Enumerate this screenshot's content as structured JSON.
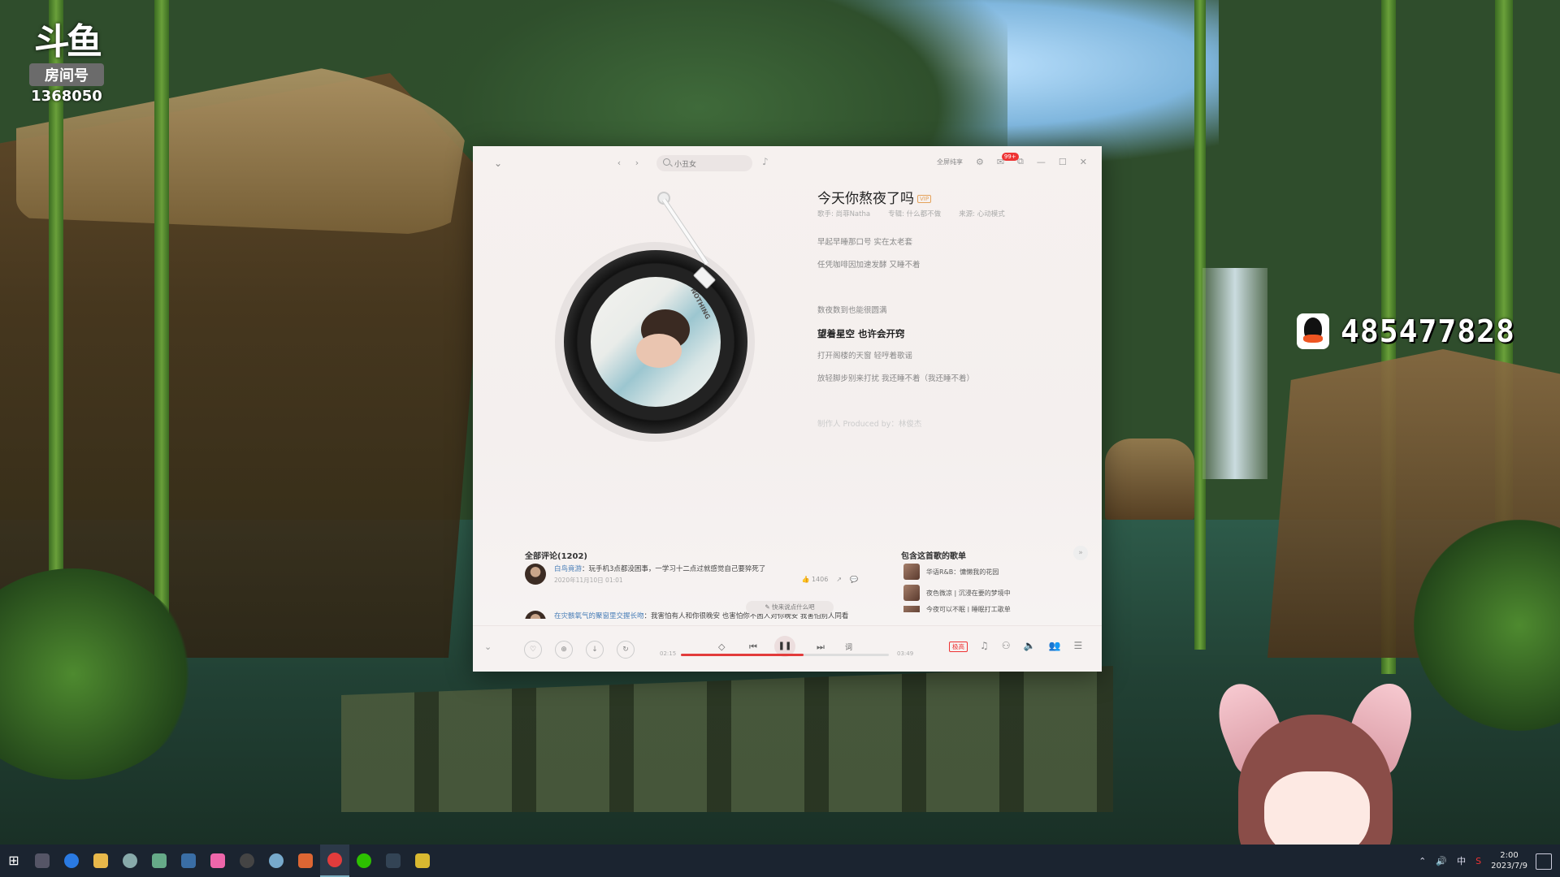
{
  "overlay": {
    "douyu_logo": "斗鱼",
    "douyu_room_label": "房间号",
    "douyu_room_number": "1368050",
    "qq_number": "485477828"
  },
  "player": {
    "search_placeholder": "小丑女",
    "fullscreen_label": "全屏纯享",
    "message_badge": "99+",
    "song": {
      "title": "今天你熬夜了吗",
      "tag": "VIP",
      "singer": "歌手: 尚菲Natha",
      "album": "专辑: 什么都不做",
      "source": "来源: 心动模式"
    },
    "cover_text": "DO NOTHING",
    "lyrics": [
      {
        "text": "早起早睡那口号 实在太老套",
        "state": "normal"
      },
      {
        "text": "任凭咖啡因加速发酵 又睡不着",
        "state": "normal"
      },
      {
        "text": "",
        "state": "normal"
      },
      {
        "text": "数夜数到也能很圆满",
        "state": "normal"
      },
      {
        "text": "望着星空 也许会开窍",
        "state": "active"
      },
      {
        "text": "打开阁楼的天窗 轻哼着歌谣",
        "state": "normal"
      },
      {
        "text": "放轻脚步别来打扰 我还睡不着（我还睡不着）",
        "state": "normal"
      },
      {
        "text": "",
        "state": "normal"
      },
      {
        "text": "制作人 Produced by：林俊杰",
        "state": "faded"
      }
    ],
    "comments": {
      "title": "全部评论(1202)",
      "items": [
        {
          "user": "白鸟竟游",
          "text": "：玩手机3点都没困事，一学习十二点过就感觉自己要猝死了",
          "time": "2020年11月10日 01:01",
          "likes": "1406"
        },
        {
          "user": "在灾骸氧气的聚窗里交握长吻",
          "text": "：我害怕有人和你很晚安 也害怕你不困人对你晚安 我害怕别人同看",
          "time": "",
          "likes": ""
        }
      ],
      "hint": "快来说点什么吧"
    },
    "playlists": {
      "title": "包含这首歌的歌单",
      "items": [
        {
          "name": "华语R&B：慵懒我的花园"
        },
        {
          "name": "夜色微凉 | 沉浸在要的梦境中"
        },
        {
          "name": "今夜可以不眠 | 睡眠打工歌单"
        }
      ]
    },
    "playbar": {
      "current_time": "02:15",
      "total_time": "03:49",
      "progress": 0.59,
      "lyric_btn": "词",
      "quality": "极高"
    }
  },
  "taskbar": {
    "time": "2:00",
    "date": "2023/7/9",
    "ime": "中"
  },
  "colors": {
    "accent": "#e23c3c",
    "window_bg": "#f6f1ef",
    "taskbar_bg": "#1b2430"
  }
}
